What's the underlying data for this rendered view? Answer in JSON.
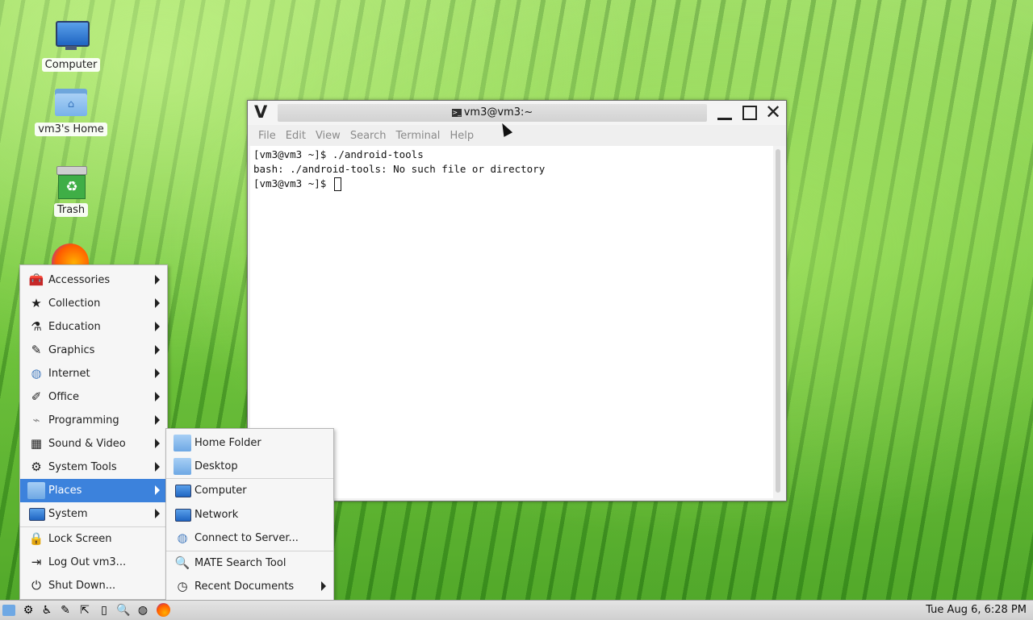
{
  "desktop": {
    "icons": [
      {
        "label": "Computer"
      },
      {
        "label": "vm3's Home"
      },
      {
        "label": "Trash"
      }
    ]
  },
  "terminal": {
    "window_letter": "V",
    "title": "vm3@vm3:~",
    "menus": [
      "File",
      "Edit",
      "View",
      "Search",
      "Terminal",
      "Help"
    ],
    "lines": [
      "[vm3@vm3 ~]$ ./android-tools",
      "bash: ./android-tools: No such file or directory",
      "[vm3@vm3 ~]$ "
    ]
  },
  "main_menu": {
    "items": [
      {
        "label": "Accessories",
        "icon": "accessories-icon",
        "submenu": true
      },
      {
        "label": "Collection",
        "icon": "star-icon",
        "submenu": true
      },
      {
        "label": "Education",
        "icon": "flask-icon",
        "submenu": true
      },
      {
        "label": "Graphics",
        "icon": "graphics-icon",
        "submenu": true
      },
      {
        "label": "Internet",
        "icon": "globe-icon",
        "submenu": true
      },
      {
        "label": "Office",
        "icon": "office-icon",
        "submenu": true
      },
      {
        "label": "Programming",
        "icon": "programming-icon",
        "submenu": true
      },
      {
        "label": "Sound & Video",
        "icon": "film-icon",
        "submenu": true
      },
      {
        "label": "System Tools",
        "icon": "gear-icon",
        "submenu": true
      },
      {
        "label": "Places",
        "icon": "folder-icon",
        "submenu": true,
        "active": true
      },
      {
        "label": "System",
        "icon": "monitor-icon",
        "submenu": true
      },
      {
        "label": "Lock Screen",
        "icon": "lock-icon",
        "submenu": false
      },
      {
        "label": "Log Out vm3...",
        "icon": "logout-icon",
        "submenu": false
      },
      {
        "label": "Shut Down...",
        "icon": "power-icon",
        "submenu": false
      }
    ]
  },
  "places_menu": {
    "items": [
      {
        "label": "Home Folder",
        "icon": "folder-icon"
      },
      {
        "label": "Desktop",
        "icon": "folder-icon"
      },
      {
        "label": "Computer",
        "icon": "monitor-icon"
      },
      {
        "label": "Network",
        "icon": "network-icon"
      },
      {
        "label": "Connect to Server...",
        "icon": "globe-icon"
      },
      {
        "label": "MATE Search Tool",
        "icon": "search-icon"
      },
      {
        "label": "Recent Documents",
        "icon": "clock-icon",
        "submenu": true
      }
    ]
  },
  "panel": {
    "clock": "Tue Aug  6,  6:28 PM"
  },
  "colors": {
    "menu_highlight": "#3c82dc"
  }
}
